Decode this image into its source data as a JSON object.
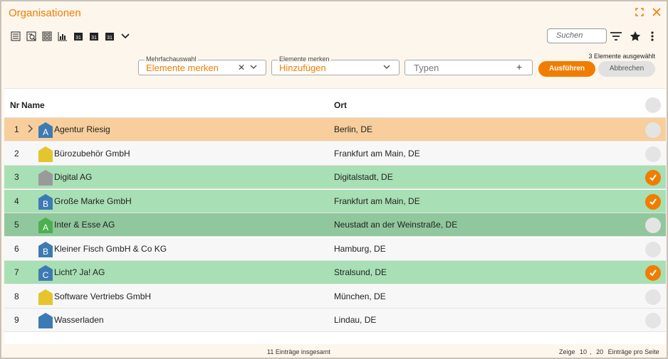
{
  "window": {
    "title": "Organisationen",
    "accent": "#f07d00"
  },
  "toolbar": {
    "icons": [
      "list-view-icon",
      "search-list-icon",
      "tile-view-icon",
      "bar-chart-icon",
      "calendar-day-icon",
      "calendar-week-icon",
      "calendar-month-icon",
      "chevron-down-icon"
    ],
    "calendar_label": "31",
    "search_placeholder": "Suchen"
  },
  "filters": {
    "mehrfach": {
      "legend": "Mehrfachauswahl",
      "value": "Elemente merken"
    },
    "merken": {
      "legend": "Elemente merken",
      "value": "Hinzufügen"
    },
    "typen": {
      "placeholder": "Typen"
    },
    "selected_count": "3 Elemente ausgewählt",
    "run_label": "Ausführen",
    "cancel_label": "Abbrechen"
  },
  "table": {
    "headers": {
      "nr": "Nr",
      "name": "Name",
      "ort": "Ort"
    },
    "rows": [
      {
        "nr": "1",
        "name": "Agentur Riesig",
        "ort": "Berlin, DE",
        "letter": "A",
        "house_color": "#3d7ab3",
        "bg": "#f7ce9c",
        "checked": false,
        "expandable": true
      },
      {
        "nr": "2",
        "name": "Bürozubehör GmbH",
        "ort": "Frankfurt am Main, DE",
        "letter": "",
        "house_color": "#e5c52e",
        "bg": "#f7f7f7",
        "checked": false,
        "expandable": false
      },
      {
        "nr": "3",
        "name": "Digital AG",
        "ort": "Digitalstadt, DE",
        "letter": "",
        "house_color": "#9a9a9a",
        "bg": "#a8dfb4",
        "checked": true,
        "expandable": false
      },
      {
        "nr": "4",
        "name": "Große Marke GmbH",
        "ort": "Frankfurt am Main, DE",
        "letter": "B",
        "house_color": "#3d7ab3",
        "bg": "#a8dfb4",
        "checked": true,
        "expandable": false
      },
      {
        "nr": "5",
        "name": "Inter & Esse AG",
        "ort": "Neustadt an der Weinstraße, DE",
        "letter": "A",
        "house_color": "#4caf50",
        "bg": "#90c79c",
        "checked": false,
        "expandable": false
      },
      {
        "nr": "6",
        "name": "Kleiner Fisch GmbH & Co KG",
        "ort": "Hamburg, DE",
        "letter": "B",
        "house_color": "#3d7ab3",
        "bg": "#f7f7f7",
        "checked": false,
        "expandable": false
      },
      {
        "nr": "7",
        "name": "Licht? Ja! AG",
        "ort": "Stralsund, DE",
        "letter": "C",
        "house_color": "#3d7ab3",
        "bg": "#a8dfb4",
        "checked": true,
        "expandable": false
      },
      {
        "nr": "8",
        "name": "Software Vertriebs GmbH",
        "ort": "München, DE",
        "letter": "",
        "house_color": "#e5c52e",
        "bg": "#f7f7f7",
        "checked": false,
        "expandable": false
      },
      {
        "nr": "9",
        "name": "Wasserladen",
        "ort": "Lindau, DE",
        "letter": "",
        "house_color": "#3d7ab3",
        "bg": "#f7f7f7",
        "checked": false,
        "expandable": false
      }
    ]
  },
  "footer": {
    "total": "11 Einträge insgesamt",
    "show_label": "Zeige",
    "page_sizes": [
      "10",
      "20"
    ],
    "separator": ",",
    "per_page_label": "Einträge pro Seite"
  }
}
